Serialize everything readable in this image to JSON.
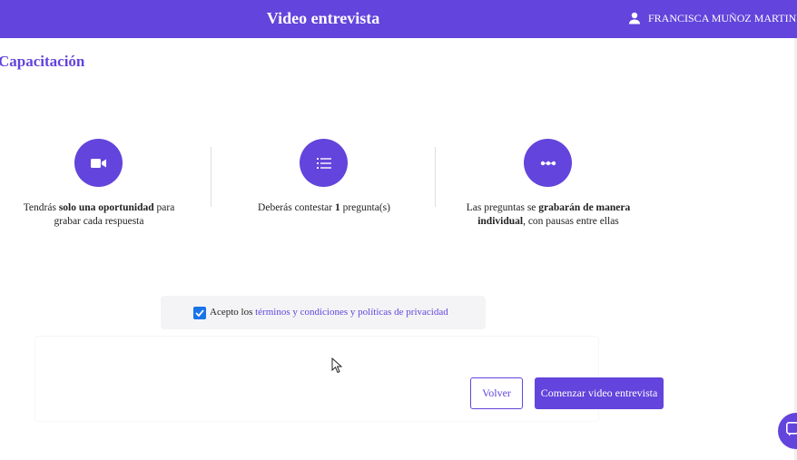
{
  "header": {
    "title": "Video entrevista",
    "user_name": "FRANCISCA MUÑOZ MARTINE"
  },
  "page": {
    "title": "Capacitación"
  },
  "features": [
    {
      "icon": "video-camera-icon",
      "pre": "Tendrás ",
      "bold": "solo una oportunidad",
      "mid": " para grabar cada respuesta",
      "bold2": "",
      "post": ""
    },
    {
      "icon": "list-icon",
      "pre": "Deberás contestar ",
      "bold": "1",
      "mid": " pregunta(s)",
      "bold2": "",
      "post": ""
    },
    {
      "icon": "dots-icon",
      "pre": "Las preguntas se ",
      "bold": "grabarán de manera individual",
      "mid": ", con pausas entre ellas",
      "bold2": "",
      "post": ""
    }
  ],
  "terms": {
    "checked": true,
    "prefix": "Acepto los ",
    "link1": "términos y condiciones",
    "joiner": " y ",
    "link2": "políticas de privacidad"
  },
  "buttons": {
    "back": "Volver",
    "start": "Comenzar video entrevista"
  },
  "colors": {
    "primary": "#6344dc",
    "checkbox": "#1a73e8"
  }
}
